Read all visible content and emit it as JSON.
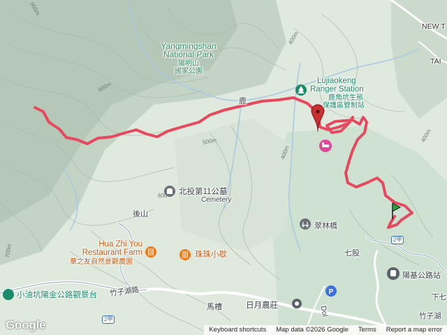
{
  "map": {
    "colors": {
      "background": "#dfe9dd",
      "forest_dark": "#b9cbbb",
      "valley": "#c9ddd2",
      "route": "#e8485d",
      "water": "#a8c8e6",
      "road": "#ffffff"
    },
    "labels": {
      "park_en_1": "Yangmingshan",
      "park_en_2": "National Park",
      "park_zh_1": "陽明山",
      "park_zh_2": "國家公園",
      "ranger_en_1": "Lujiaokeng",
      "ranger_en_2": "Ranger Station",
      "ranger_zh_1": "鹿角坑生態",
      "ranger_zh_2": "保護區管制站",
      "road_top": "鹿",
      "cemetery_zh": "北投第11公墓",
      "cemetery_en": "Cemetery",
      "houshan": "後山",
      "farm_en_1": "Hua Zhi You",
      "farm_en_2": "Restaurant Farm",
      "farm_zh": "華之友自然景觀農園",
      "zhuzhu": "珠珠小歇",
      "cuilin_bridge": "翠林橋",
      "qigu": "七股",
      "yangjin_road_right": "陽基公路站",
      "xiaoyoukeng": "小油坑陽金公路觀景台",
      "zhuzi_lake_road": "竹子湖路",
      "zhuzi_lake_road_right": "竹子湖",
      "xia_right": "下七",
      "macao": "馬槽",
      "riyue_farm": "日月農莊",
      "route_shield_2": "2甲",
      "route_shield_2b": "2甲",
      "new_label": "NEW T",
      "tai_label": "TAI",
      "contour_400": "400m",
      "contour_500": "500m",
      "contour_600": "600m",
      "contour_600b": "600",
      "contour_700": "700m",
      "contour_800": "800m",
      "contour_400b": "400m",
      "contour_400c": "400m",
      "bottom_road": "Dol"
    },
    "footer": {
      "google": "Google",
      "shortcuts": "Keyboard shortcuts",
      "map_data": "Map data ©2026 Google",
      "terms": "Terms",
      "report": "Report a map error"
    }
  }
}
